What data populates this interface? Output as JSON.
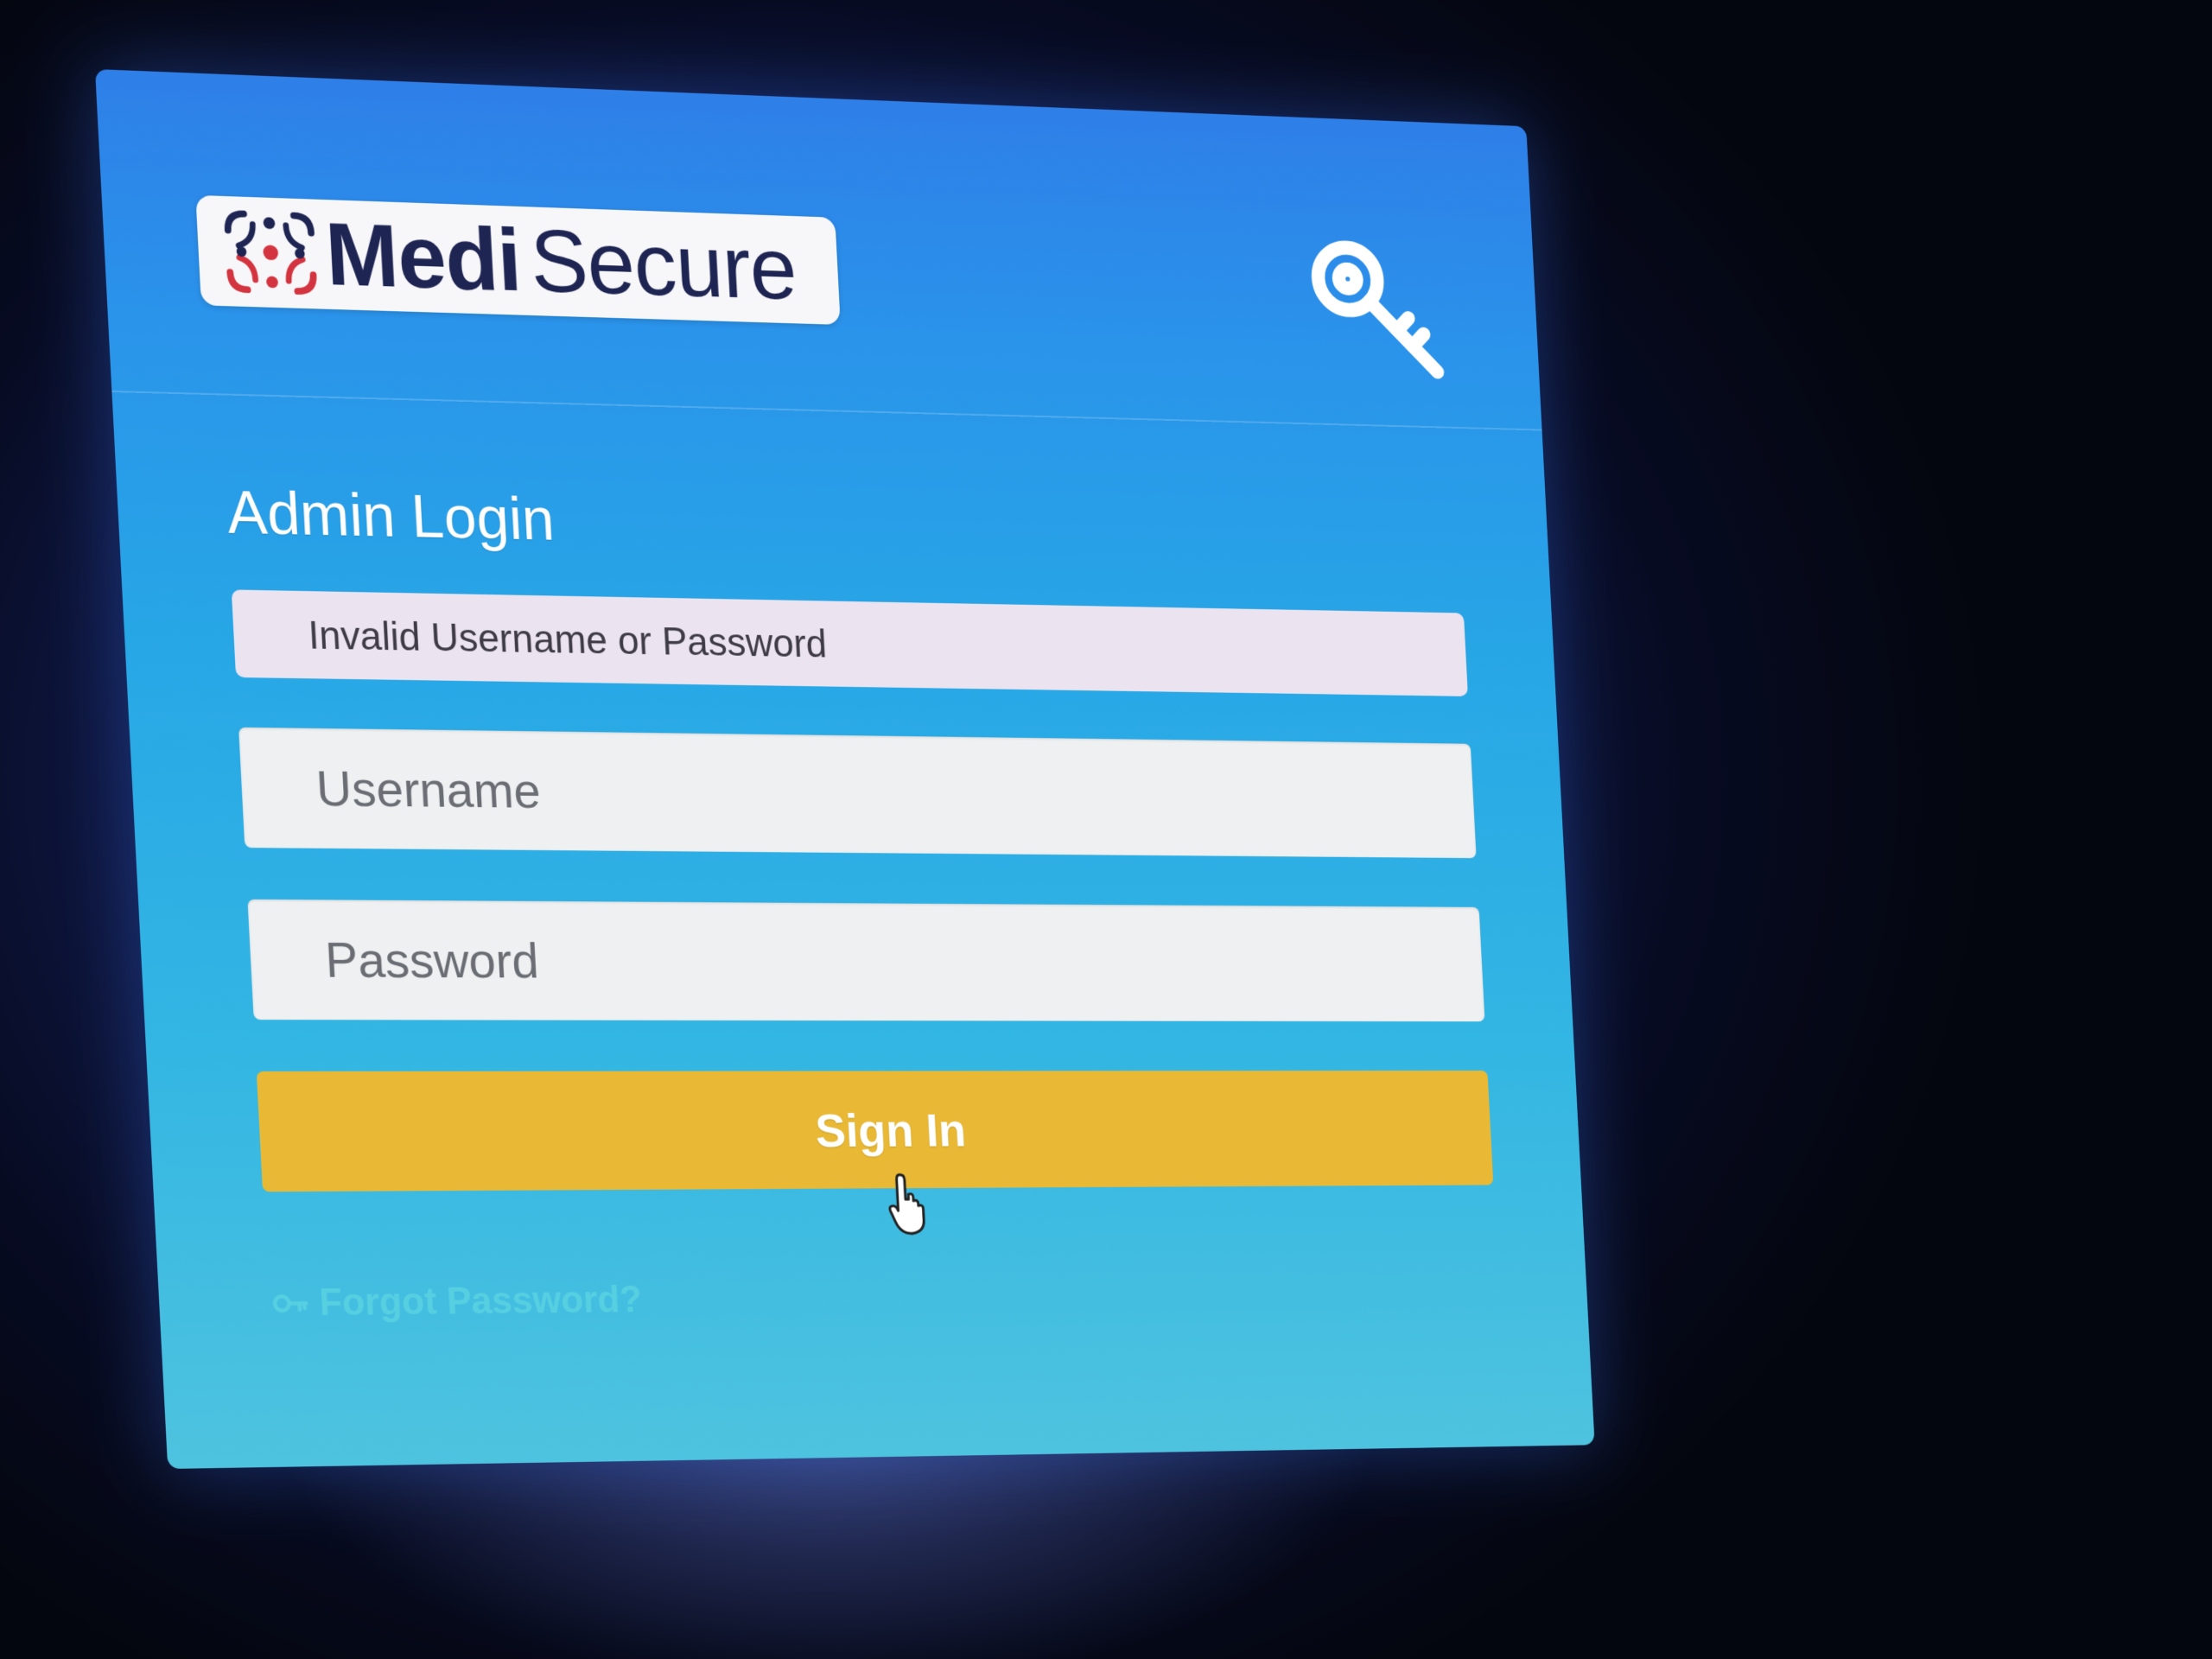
{
  "brand": {
    "name_bold": "Medi",
    "name_regular": "Secure"
  },
  "login": {
    "title": "Admin Login",
    "error_message": "Invalid Username or Password",
    "username_placeholder": "Username",
    "username_value": "",
    "password_placeholder": "Password",
    "password_value": "",
    "signin_label": "Sign In",
    "forgot_label": "Forgot Password?"
  },
  "icons": {
    "header": "key-icon",
    "logo": "medisecure-logo-mark",
    "forgot": "key-icon",
    "pointer": "hand-pointer-cursor"
  },
  "colors": {
    "card_top": "#2e7fe8",
    "card_bottom": "#4ec3df",
    "button": "#e9b935",
    "alert_bg": "#ece3f1",
    "brand_dark": "#1f2553",
    "logo_red": "#d3343f",
    "link": "#5ad3e2"
  }
}
